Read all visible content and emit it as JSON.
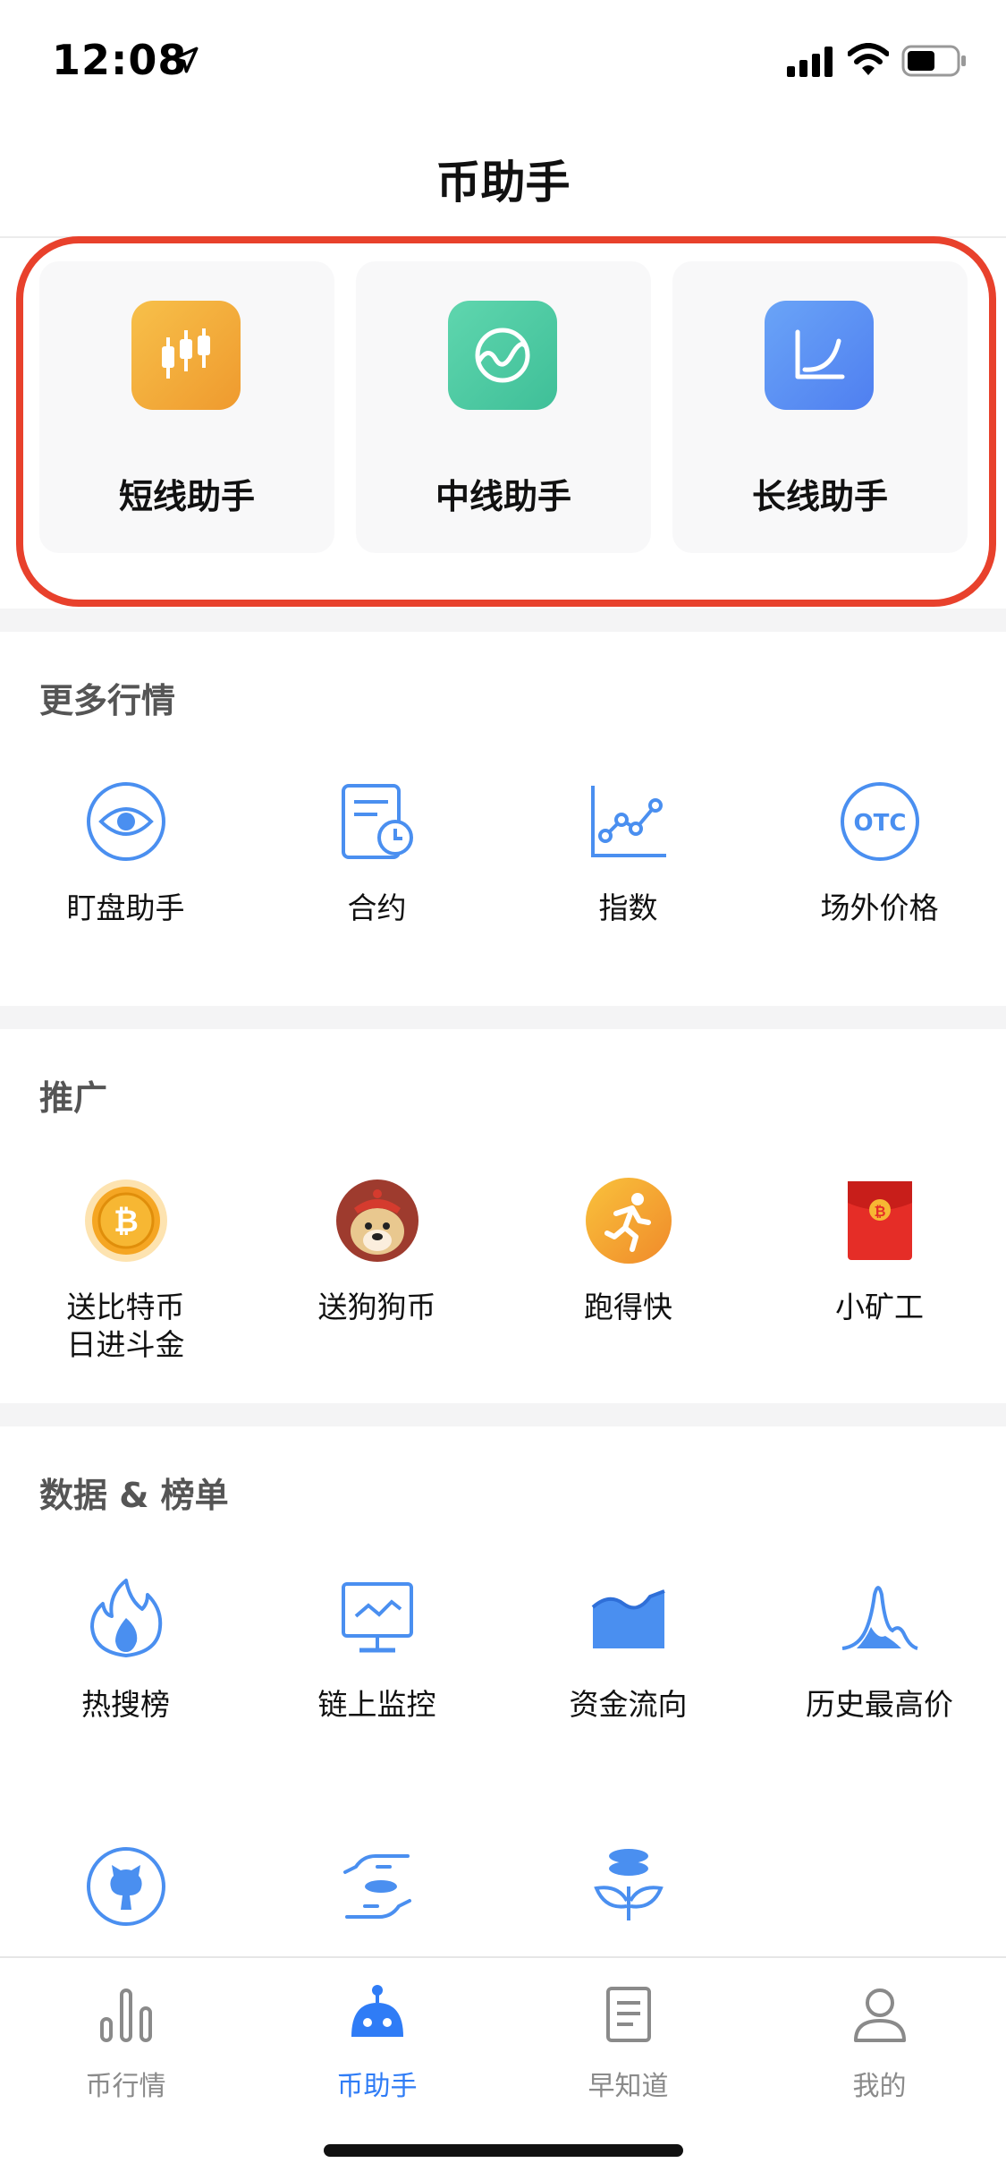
{
  "status_bar": {
    "time": "12:08"
  },
  "nav": {
    "title": "币助手"
  },
  "assistants": [
    {
      "label": "短线助手",
      "icon": "candlestick-icon",
      "color": "#f4a93a"
    },
    {
      "label": "中线助手",
      "icon": "wave-chart-icon",
      "color": "#4fcca4"
    },
    {
      "label": "长线助手",
      "icon": "curve-chart-icon",
      "color": "#5b8ef5"
    }
  ],
  "sections": {
    "market": {
      "title": "更多行情",
      "items": [
        {
          "label": "盯盘助手",
          "icon": "eye-icon"
        },
        {
          "label": "合约",
          "icon": "contract-clock-icon"
        },
        {
          "label": "指数",
          "icon": "index-chart-icon"
        },
        {
          "label": "场外价格",
          "icon": "otc-icon"
        }
      ]
    },
    "promo": {
      "title": "推广",
      "items": [
        {
          "label": "送比特币\n日进斗金",
          "line1": "送比特币",
          "line2": "日进斗金",
          "icon": "bitcoin-coin-icon"
        },
        {
          "label": "送狗狗币",
          "icon": "doge-icon"
        },
        {
          "label": "跑得快",
          "icon": "runner-icon"
        },
        {
          "label": "小矿工",
          "icon": "red-envelope-icon"
        }
      ]
    },
    "data": {
      "title": "数据 & 榜单",
      "items": [
        {
          "label": "热搜榜",
          "icon": "fire-icon"
        },
        {
          "label": "链上监控",
          "icon": "monitor-icon"
        },
        {
          "label": "资金流向",
          "icon": "flow-area-icon"
        },
        {
          "label": "历史最高价",
          "icon": "peak-chart-icon"
        },
        {
          "label": "",
          "icon": "github-icon"
        },
        {
          "label": "",
          "icon": "hand-coin-icon"
        },
        {
          "label": "",
          "icon": "coin-plant-icon"
        }
      ]
    }
  },
  "tabs": [
    {
      "label": "币行情",
      "icon": "bar-chart-icon",
      "active": false
    },
    {
      "label": "币助手",
      "icon": "robot-icon",
      "active": true
    },
    {
      "label": "早知道",
      "icon": "document-icon",
      "active": false
    },
    {
      "label": "我的",
      "icon": "user-icon",
      "active": false
    }
  ],
  "colors": {
    "accent": "#2f7cf6",
    "icon_blue": "#4a8ff0",
    "highlight": "#e8412c"
  }
}
